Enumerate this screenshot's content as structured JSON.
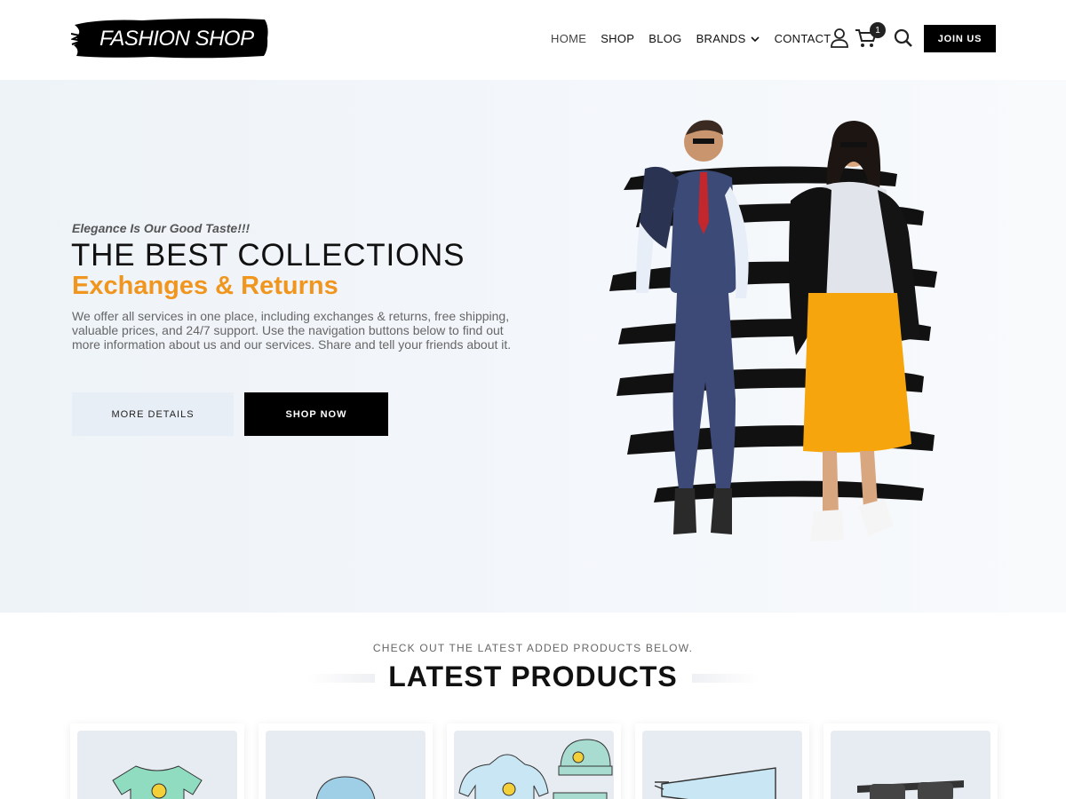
{
  "header": {
    "logo_text": "FASHION SHOP",
    "nav": [
      {
        "label": "HOME"
      },
      {
        "label": "SHOP"
      },
      {
        "label": "BLOG"
      },
      {
        "label": "BRANDS"
      },
      {
        "label": "CONTACT"
      }
    ],
    "cart_count": "1",
    "join_label": "JOIN US",
    "icons": [
      "user-icon",
      "cart-icon",
      "search-icon",
      "chevron-down-icon"
    ]
  },
  "hero": {
    "tagline": "Elegance Is Our Good Taste!!!",
    "title": "THE BEST COLLECTIONS",
    "subtitle": "Exchanges & Returns",
    "description": "We offer all services in one place, including exchanges & returns, free shipping, valuable prices, and 24/7 support. Use the navigation buttons below to find out more information about us and our services. Share and tell your friends about it.",
    "more_button": "MORE DETAILS",
    "shop_button": "SHOP NOW",
    "accent_color": "#f0961e"
  },
  "latest": {
    "kicker": "CHECK OUT THE LATEST ADDED PRODUCTS BELOW.",
    "title": "LATEST PRODUCTS"
  }
}
